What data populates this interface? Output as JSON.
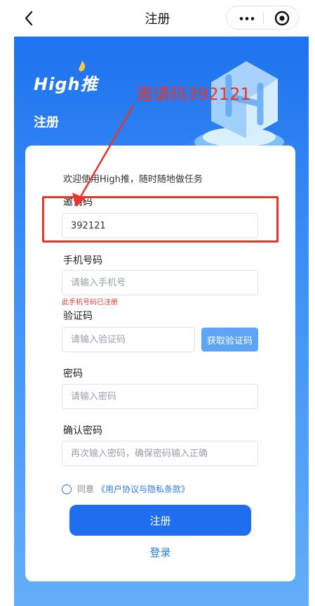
{
  "navbar": {
    "title": "注册"
  },
  "hero": {
    "brand_text": "High推",
    "heading": "注册"
  },
  "annotation": {
    "text": "邀请码392121"
  },
  "form": {
    "welcome": "欢迎使用High推，随时随地做任务",
    "invite": {
      "label": "邀请码",
      "value": "392121"
    },
    "phone": {
      "label": "手机号码",
      "placeholder": "请输入手机号",
      "error": "此手机号码已注册"
    },
    "code": {
      "label": "验证码",
      "placeholder": "请输入验证码",
      "button": "获取验证码"
    },
    "password": {
      "label": "密码",
      "placeholder": "请输入密码"
    },
    "confirm": {
      "label": "确认密码",
      "placeholder": "再次输入密码，确保密码输入正确"
    },
    "agreement": {
      "prefix": "同意",
      "link": "《用户协议与隐私条款》"
    },
    "submit_label": "注册",
    "login_label": "登录"
  },
  "colors": {
    "primary": "#1f6ef0",
    "annotation": "#e8352b",
    "error": "#e53935"
  }
}
